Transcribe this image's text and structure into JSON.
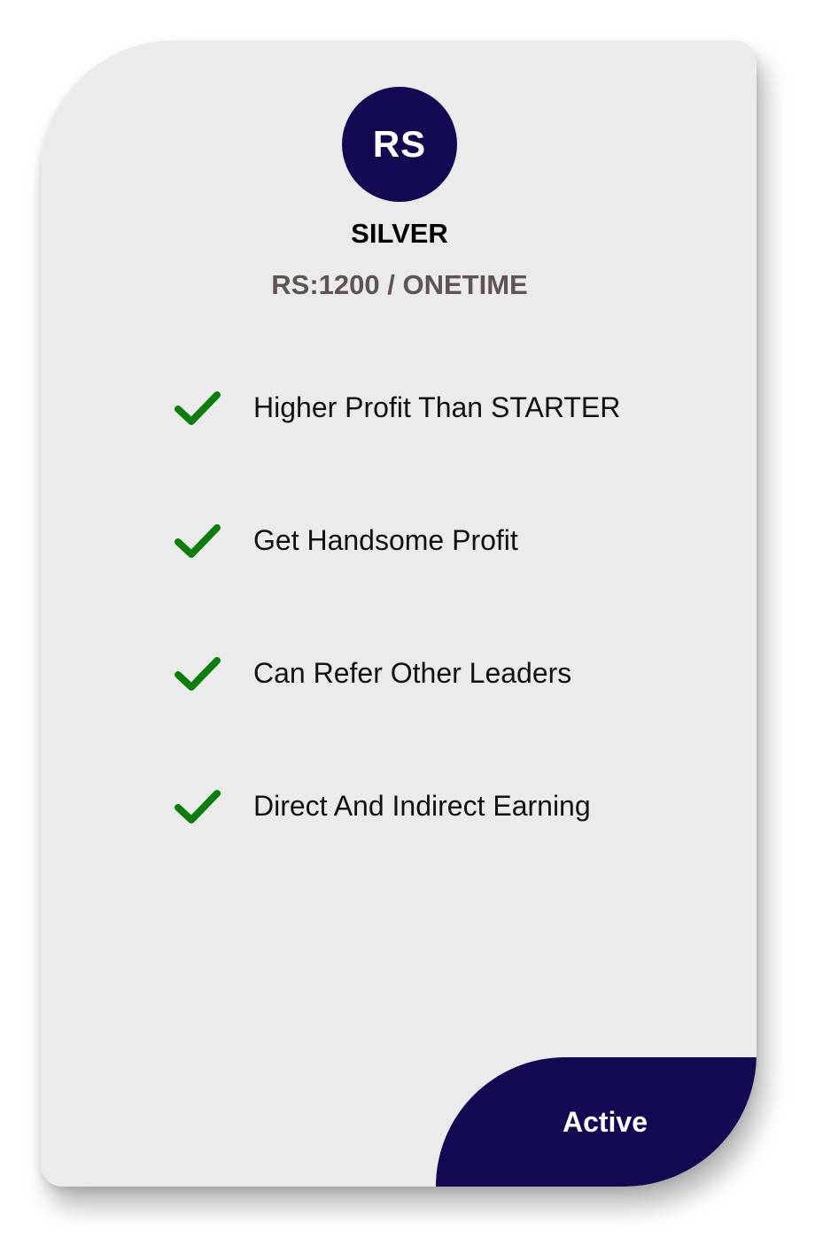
{
  "plan": {
    "avatar_initials": "RS",
    "name": "SILVER",
    "price": "RS:1200 / ONETIME",
    "features": [
      {
        "icon": "check-icon",
        "text": "Higher Profit Than STARTER"
      },
      {
        "icon": "check-icon",
        "text": "Get Handsome Profit"
      },
      {
        "icon": "check-icon",
        "text": "Can Refer Other Leaders"
      },
      {
        "icon": "check-icon",
        "text": "Direct And Indirect Earning"
      }
    ],
    "button_label": "Active"
  },
  "colors": {
    "card_background": "#ebebeb",
    "accent": "#110a52",
    "check": "#0b7d0b",
    "price_text": "#5e5452"
  }
}
